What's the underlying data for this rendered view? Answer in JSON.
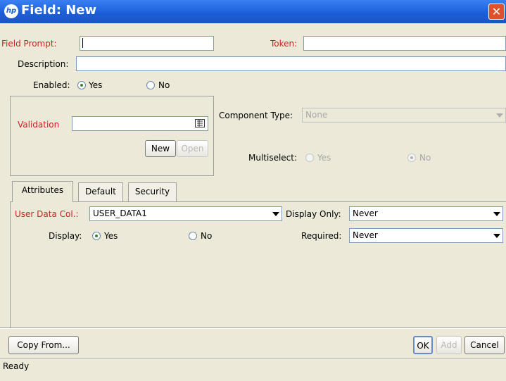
{
  "window": {
    "title": "Field: New",
    "logo_text": "hp",
    "close_glyph": "✕"
  },
  "field_prompt": {
    "label": "Field Prompt:",
    "value": ""
  },
  "token": {
    "label": "Token:",
    "value": ""
  },
  "description": {
    "label": "Description:",
    "value": ""
  },
  "enabled": {
    "label": "Enabled:",
    "yes": "Yes",
    "no": "No",
    "selected": "Yes"
  },
  "validation": {
    "label": "Validation",
    "value": "",
    "new_label": "New",
    "open_label": "Open"
  },
  "component_type": {
    "label": "Component Type:",
    "value": "None"
  },
  "multiselect": {
    "label": "Multiselect:",
    "yes": "Yes",
    "no": "No",
    "selected": "No"
  },
  "tabs": [
    {
      "label": "Attributes",
      "active": true
    },
    {
      "label": "Default",
      "active": false
    },
    {
      "label": "Security",
      "active": false
    }
  ],
  "attributes": {
    "user_data_col": {
      "label": "User Data Col.:",
      "value": "USER_DATA1"
    },
    "display_only": {
      "label": "Display Only:",
      "value": "Never"
    },
    "display": {
      "label": "Display:",
      "yes": "Yes",
      "no": "No",
      "selected": "Yes"
    },
    "required": {
      "label": "Required:",
      "value": "Never"
    }
  },
  "buttons": {
    "copy_from": "Copy From...",
    "ok": "OK",
    "add": "Add",
    "cancel": "Cancel"
  },
  "status": "Ready",
  "colors": {
    "titlebar": "#1d5fd8",
    "required_label": "#cc2222",
    "dialog_bg": "#ece9d8"
  }
}
